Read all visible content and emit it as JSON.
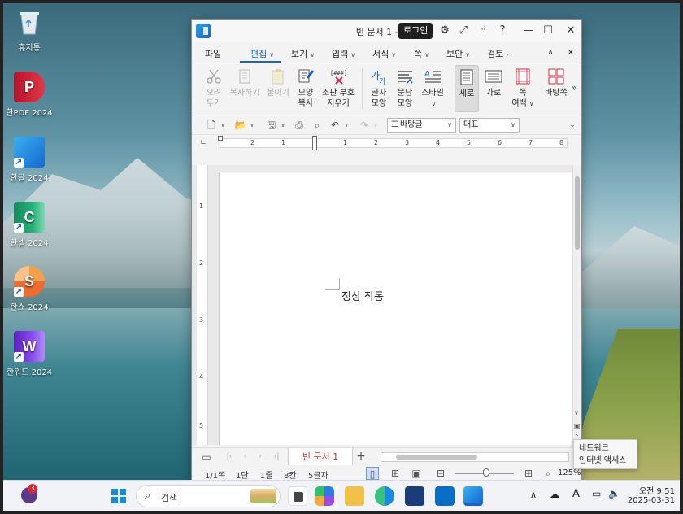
{
  "desktop": {
    "icons": [
      {
        "label": "휴지통",
        "icon": "recycle-bin-icon"
      },
      {
        "label": "한PDF 2024",
        "icon": "hanpdf-icon",
        "color": "#d8263c"
      },
      {
        "label": "한글 2024",
        "icon": "hangul-icon",
        "color": "#1a7fe0"
      },
      {
        "label": "한셀 2024",
        "icon": "hancell-icon",
        "color": "#1f9d6a"
      },
      {
        "label": "한쇼 2024",
        "icon": "hanshow-icon",
        "color": "#ef6b2d"
      },
      {
        "label": "한워드 2024",
        "icon": "hanword-icon",
        "color": "#7b3fe0"
      }
    ]
  },
  "window": {
    "title": "빈 문서 1 - 호글",
    "login_label": "로그인",
    "menu": [
      {
        "label": "파일"
      },
      {
        "label": "편집",
        "active": true
      },
      {
        "label": "보기"
      },
      {
        "label": "입력"
      },
      {
        "label": "서식"
      },
      {
        "label": "쪽"
      },
      {
        "label": "보안"
      },
      {
        "label": "검토"
      }
    ],
    "ribbon": [
      {
        "line1": "오려",
        "line2": "두기",
        "icon": "scissors-icon",
        "enabled": false
      },
      {
        "line1": "복사하기",
        "line2": "",
        "icon": "copy-icon",
        "enabled": false
      },
      {
        "line1": "붙이기",
        "line2": "",
        "icon": "paste-icon",
        "enabled": false
      },
      {
        "line1": "모양",
        "line2": "복사",
        "icon": "format-painter-icon",
        "enabled": true
      },
      {
        "line1": "조판 부호",
        "line2": "지우기",
        "icon": "clear-codes-icon",
        "enabled": true
      },
      {
        "line1": "글자",
        "line2": "모양",
        "icon": "char-shape-icon",
        "enabled": true
      },
      {
        "line1": "문단",
        "line2": "모양",
        "icon": "para-shape-icon",
        "enabled": true
      },
      {
        "line1": "스타일",
        "line2": "",
        "icon": "style-icon",
        "enabled": true
      },
      {
        "line1": "세로",
        "line2": "",
        "icon": "portrait-icon",
        "enabled": true,
        "selected": true
      },
      {
        "line1": "가로",
        "line2": "",
        "icon": "landscape-icon",
        "enabled": true
      },
      {
        "line1": "쪽",
        "line2": "여백",
        "icon": "page-margin-icon",
        "enabled": true
      },
      {
        "line1": "바탕쪽",
        "line2": "",
        "icon": "master-page-icon",
        "enabled": true
      }
    ],
    "toolbar": {
      "style_select": "바탕글",
      "font_select": "대표"
    },
    "hruler_ticks": [
      "2",
      "1",
      "1",
      "2",
      "3",
      "4",
      "5",
      "6",
      "7",
      "8"
    ],
    "vruler_ticks": [
      "1",
      "2",
      "3",
      "4",
      "5"
    ],
    "document": {
      "body_text": "정상 작동"
    },
    "doc_tab": "빈 문서 1",
    "add_tab": "+",
    "status": {
      "page": "1/1쪽",
      "column": "1단",
      "line": "1줄",
      "col": "8칸",
      "chars": "5글자",
      "zoom": "125%"
    }
  },
  "tooltip": {
    "line1": "네트워크",
    "line2": "인터넷 액세스"
  },
  "taskbar": {
    "search_placeholder": "검색",
    "notification_count": "3",
    "ime": "A",
    "time": "오전 9:51",
    "date": "2025-03-31"
  }
}
